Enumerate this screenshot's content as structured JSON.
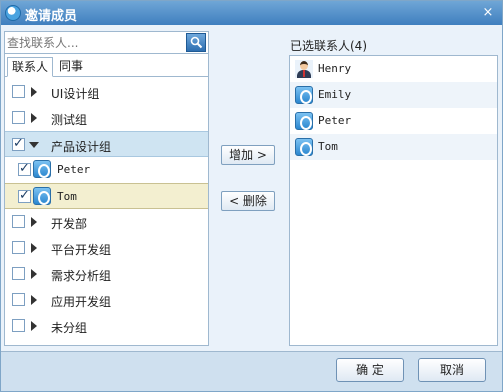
{
  "window": {
    "title": "邀请成员",
    "close_glyph": "×"
  },
  "search": {
    "placeholder": "查找联系人..."
  },
  "tabs": [
    {
      "label": "联系人"
    },
    {
      "label": "同事"
    }
  ],
  "tree": {
    "groups_before": [
      {
        "label": "UI设计组",
        "checked": false
      },
      {
        "label": "测试组",
        "checked": false
      }
    ],
    "expanded_group": {
      "label": "产品设计组",
      "checked": true
    },
    "children": [
      {
        "label": "Peter",
        "checked": true
      },
      {
        "label": "Tom",
        "checked": true
      }
    ],
    "groups_after": [
      {
        "label": "开发部"
      },
      {
        "label": "平台开发组"
      },
      {
        "label": "需求分析组"
      },
      {
        "label": "应用开发组"
      },
      {
        "label": "未分组"
      }
    ]
  },
  "actions": {
    "add_label": "增加 >",
    "remove_label": "< 删除"
  },
  "selected": {
    "title": "已选联系人(4)",
    "items": [
      {
        "label": "Henry",
        "icon": "person-avatar-icon"
      },
      {
        "label": "Emily",
        "icon": "qq-avatar-icon"
      },
      {
        "label": "Peter",
        "icon": "qq-avatar-icon"
      },
      {
        "label": "Tom",
        "icon": "qq-avatar-icon"
      }
    ]
  },
  "footer": {
    "ok_label": "确 定",
    "cancel_label": "取消"
  },
  "colors": {
    "titlebar": "#3f7fbf",
    "expanded_row": "#cfe4f2",
    "selected_row": "#f3efd0"
  }
}
